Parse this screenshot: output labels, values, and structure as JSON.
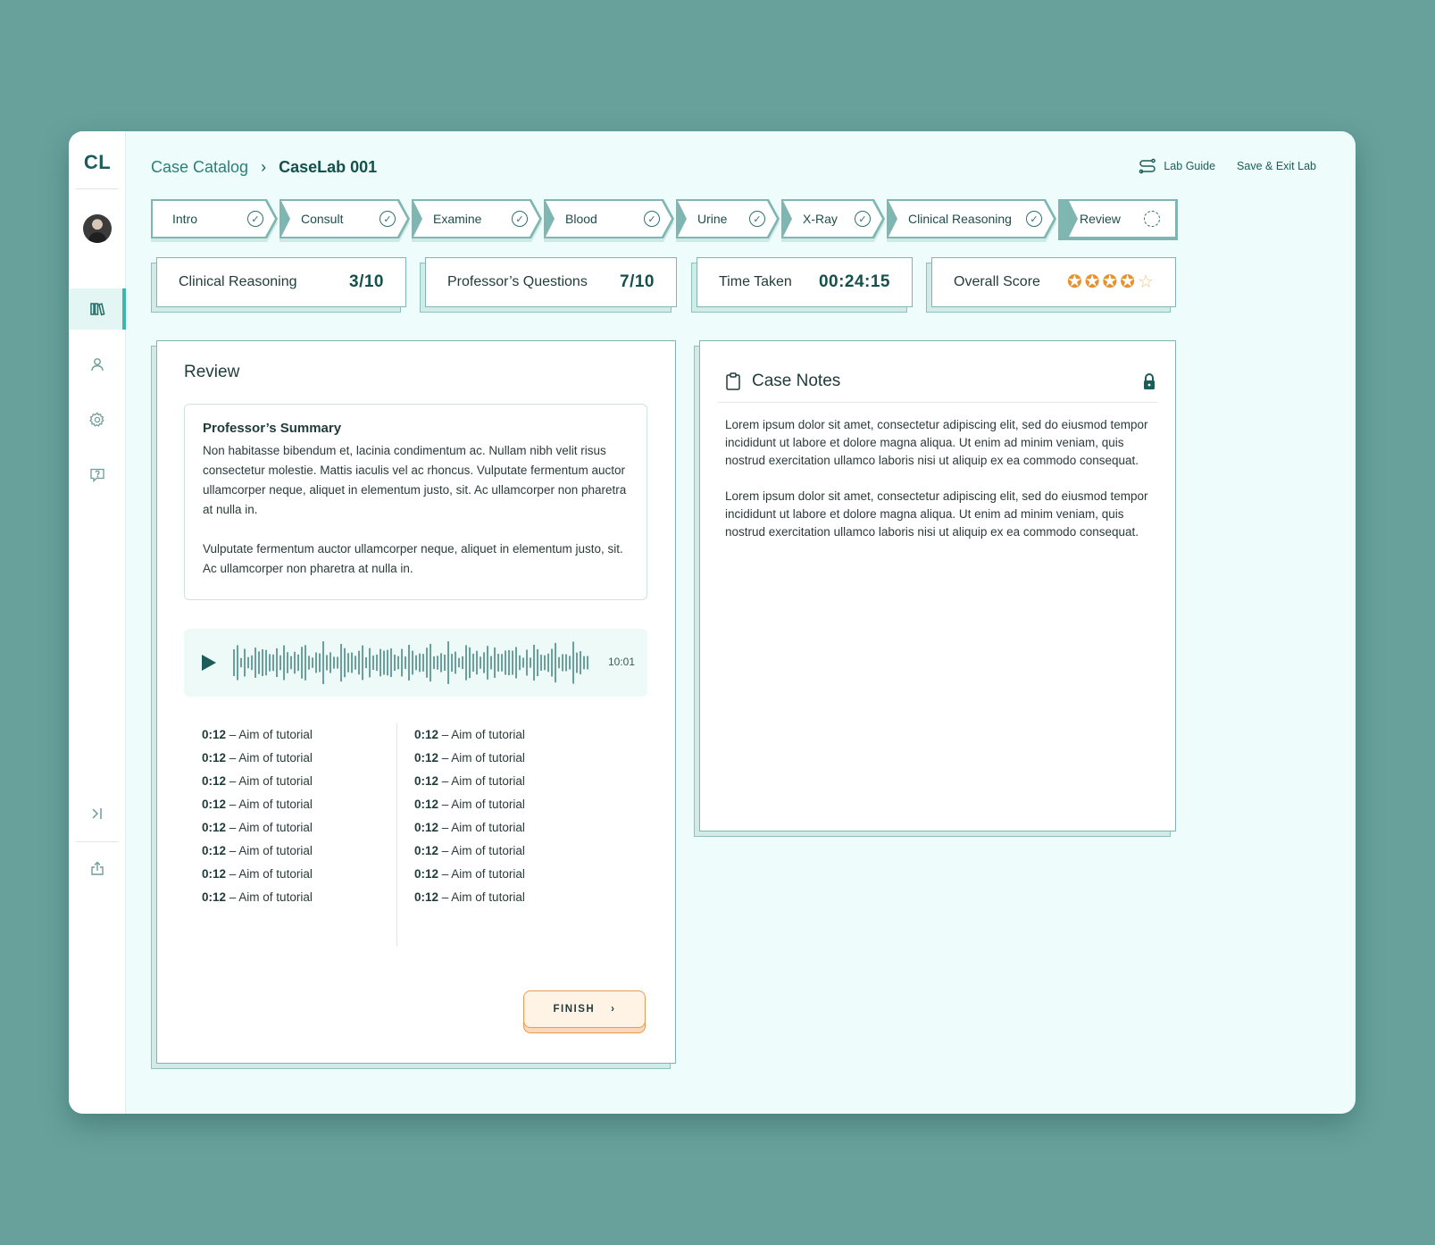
{
  "app": {
    "logo": "CL"
  },
  "breadcrumb": {
    "parent": "Case Catalog",
    "separator": "›",
    "current": "CaseLab 001"
  },
  "header": {
    "lab_guide": "Lab Guide",
    "save_exit": "Save & Exit Lab"
  },
  "steps": [
    {
      "label": "Intro",
      "status": "complete"
    },
    {
      "label": "Consult",
      "status": "complete"
    },
    {
      "label": "Examine",
      "status": "complete"
    },
    {
      "label": "Blood",
      "status": "complete"
    },
    {
      "label": "Urine",
      "status": "complete"
    },
    {
      "label": "X-Ray",
      "status": "complete"
    },
    {
      "label": "Clinical Reasoning",
      "status": "complete"
    },
    {
      "label": "Review",
      "status": "in-progress"
    }
  ],
  "stats": {
    "clinical_reasoning": {
      "label": "Clinical Reasoning",
      "value": "3/10"
    },
    "professor_questions": {
      "label": "Professor’s Questions",
      "value": "7/10"
    },
    "time_taken": {
      "label": "Time Taken",
      "value": "00:24:15"
    },
    "overall_score": {
      "label": "Overall Score",
      "stars": 4,
      "max_stars": 5
    }
  },
  "review": {
    "title": "Review",
    "summary_title": "Professor’s Summary",
    "summary_p1": "Non habitasse bibendum et, lacinia condimentum ac. Nullam nibh velit risus consectetur molestie. Mattis iaculis vel ac rhoncus. Vulputate fermentum auctor ullamcorper neque, aliquet in elementum justo, sit. Ac ullamcorper non pharetra at nulla in.",
    "summary_p2": "Vulputate fermentum auctor ullamcorper neque, aliquet in elementum justo, sit. Ac ullamcorper non pharetra at nulla in.",
    "audio_duration": "10:01",
    "chapters_left": [
      {
        "time": "0:12",
        "text": " – Aim of tutorial"
      },
      {
        "time": "0:12",
        "text": " – Aim of tutorial"
      },
      {
        "time": "0:12",
        "text": " – Aim of tutorial"
      },
      {
        "time": "0:12",
        "text": " – Aim of tutorial"
      },
      {
        "time": "0:12",
        "text": " – Aim of tutorial"
      },
      {
        "time": "0:12",
        "text": " – Aim of tutorial"
      },
      {
        "time": "0:12",
        "text": " – Aim of tutorial"
      },
      {
        "time": "0:12",
        "text": " – Aim of tutorial"
      }
    ],
    "chapters_right": [
      {
        "time": "0:12",
        "text": " – Aim of tutorial"
      },
      {
        "time": "0:12",
        "text": " – Aim of tutorial"
      },
      {
        "time": "0:12",
        "text": " – Aim of tutorial"
      },
      {
        "time": "0:12",
        "text": " – Aim of tutorial"
      },
      {
        "time": "0:12",
        "text": " – Aim of tutorial"
      },
      {
        "time": "0:12",
        "text": " – Aim of tutorial"
      },
      {
        "time": "0:12",
        "text": " – Aim of tutorial"
      },
      {
        "time": "0:12",
        "text": " – Aim of tutorial"
      }
    ],
    "finish_label": "FINISH"
  },
  "notes": {
    "title": "Case Notes",
    "p1": "Lorem ipsum dolor sit amet, consectetur adipiscing elit, sed do eiusmod tempor incididunt ut labore et dolore magna aliqua. Ut enim ad minim veniam, quis nostrud exercitation ullamco laboris nisi ut aliquip ex ea commodo consequat.",
    "p2": "Lorem ipsum dolor sit amet, consectetur adipiscing elit, sed do eiusmod tempor incididunt ut labore et dolore magna aliqua. Ut enim ad minim veniam, quis nostrud exercitation ullamco laboris nisi ut aliquip ex ea commodo consequat."
  },
  "icons": {
    "sidebar": [
      "library-icon",
      "user-icon",
      "gear-icon",
      "help-chat-icon",
      "collapse-sidebar-icon",
      "share-icon"
    ],
    "header": "route-icon",
    "notes": [
      "clipboard-icon",
      "lock-icon"
    ]
  },
  "colors": {
    "brand": "#1c5d59",
    "accent": "#3bb8ad",
    "finish": "#e99a52",
    "star": "#e5932e"
  }
}
